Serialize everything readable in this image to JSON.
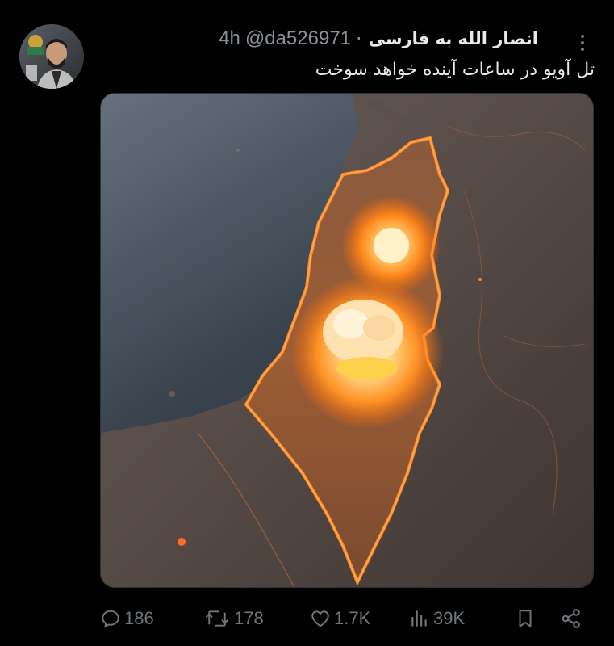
{
  "tweet": {
    "display_name": "انصار الله به فارسی",
    "handle": "@da526971",
    "separator": "·",
    "timestamp": "4h",
    "text": "تل آویو در ساعات آینده خواهد سوخت",
    "media_description_icon": "image"
  },
  "actions": {
    "reply_count": "186",
    "repost_count": "178",
    "like_count": "1.7K",
    "view_count": "39K"
  },
  "icons": {
    "reply": "speech-bubble-icon",
    "repost": "repost-arrows-icon",
    "like": "heart-icon",
    "views": "bar-chart-icon",
    "bookmark": "bookmark-icon",
    "share": "share-icon",
    "more": "more-dots-icon"
  },
  "colors": {
    "background": "#000000",
    "text_primary": "#e7e9ea",
    "text_secondary": "#71767b",
    "map_glow": "#ff7a1a"
  }
}
